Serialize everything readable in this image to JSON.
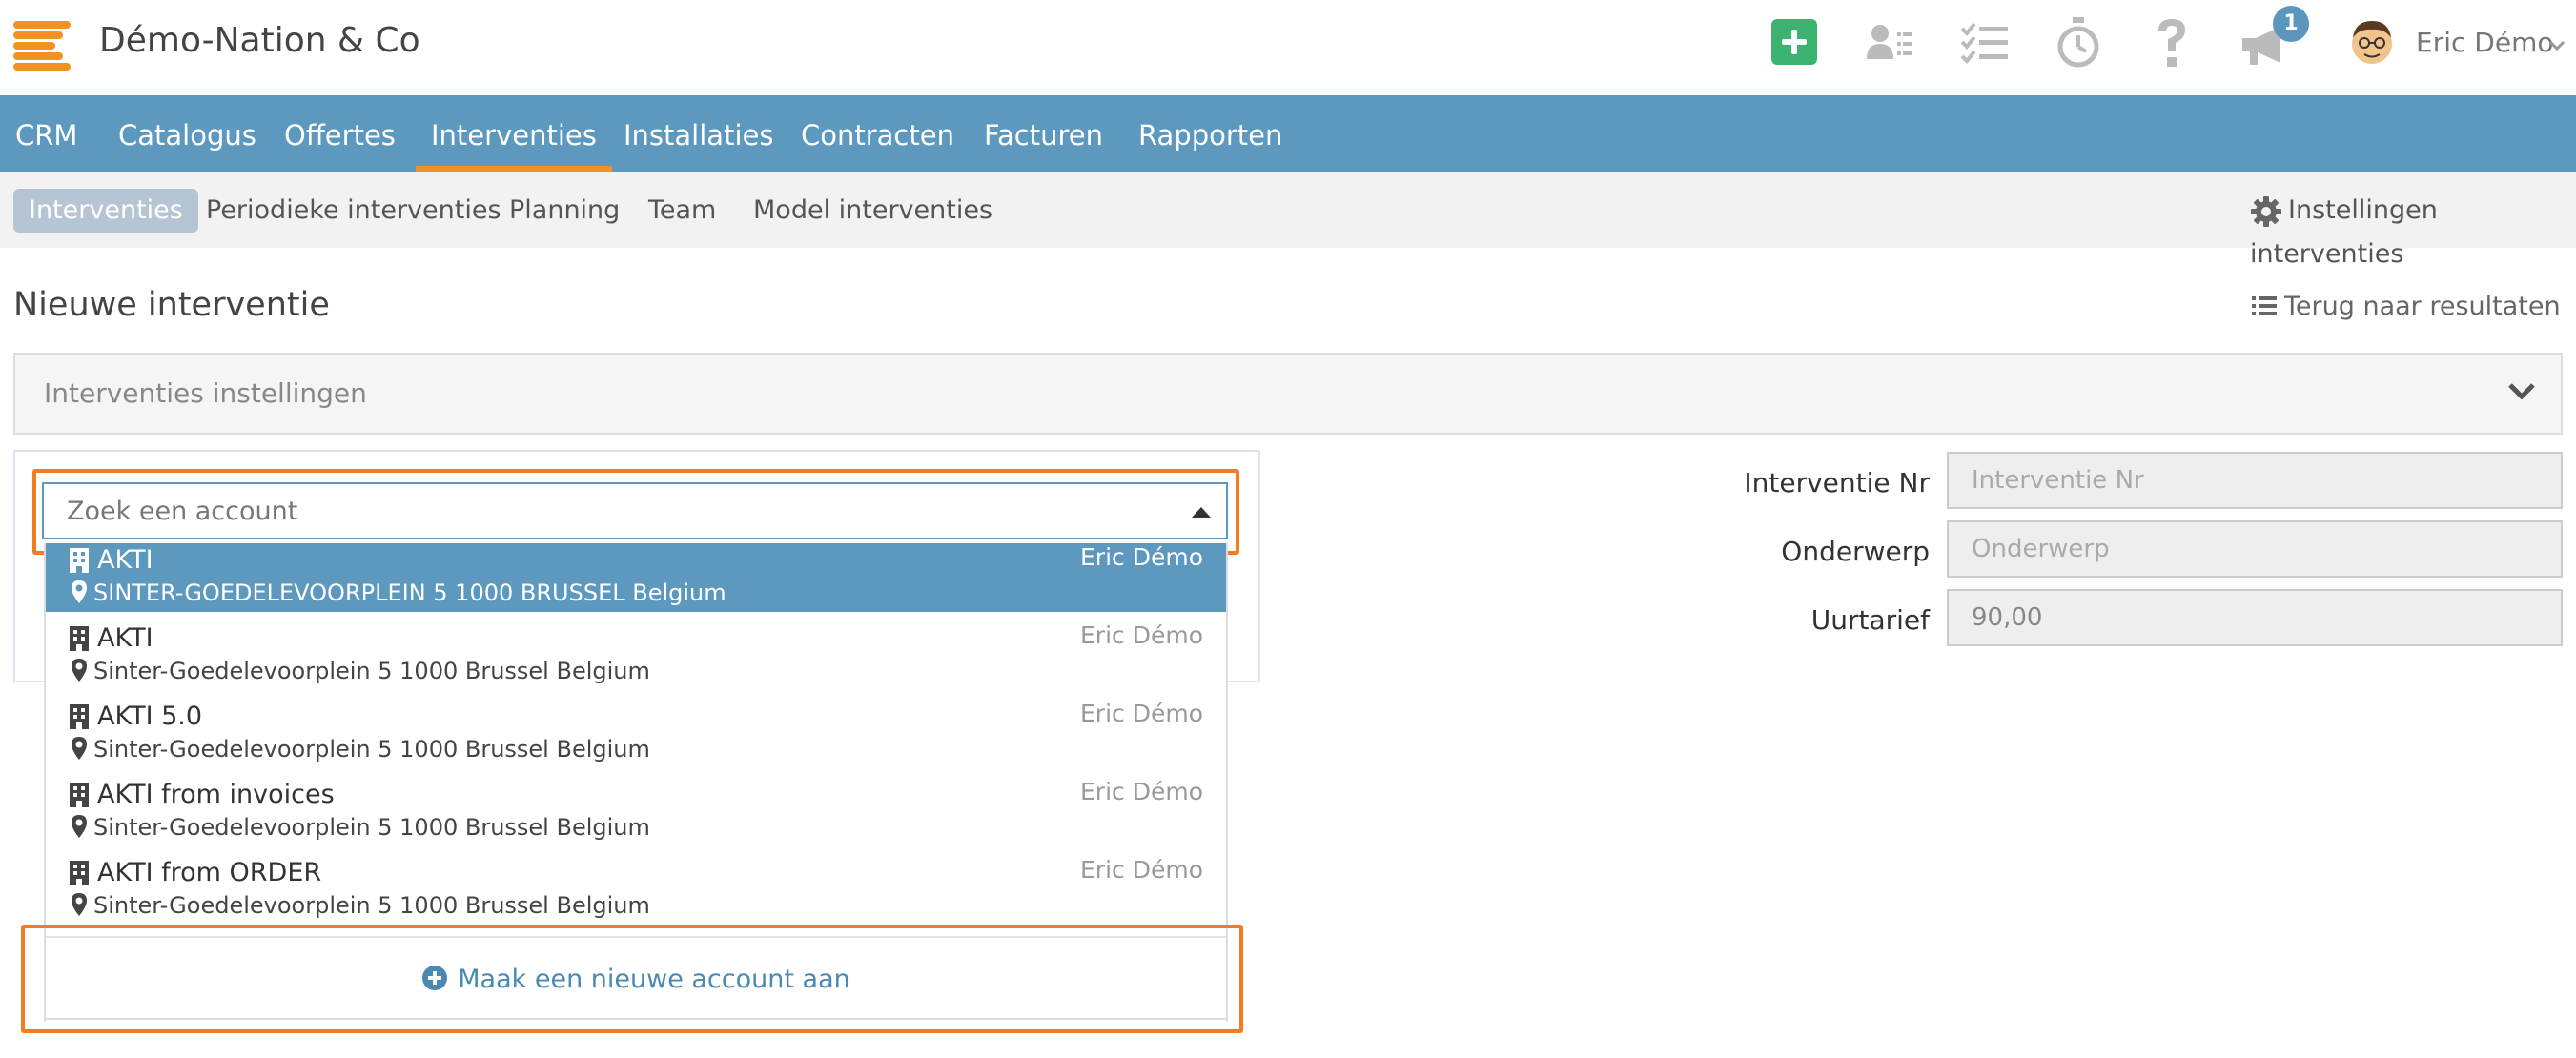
{
  "header": {
    "company": "Démo-Nation & Co",
    "notification_count": "1",
    "user_name": "Eric Démo",
    "icons": [
      "menu-logo-icon",
      "plus-icon",
      "contacts-icon",
      "tasks-icon",
      "stopwatch-icon",
      "help-icon",
      "megaphone-icon",
      "avatar",
      "chevron-down-icon"
    ],
    "colors": {
      "accent": "#f39222",
      "nav": "#5d98be",
      "add": "#3cb371"
    }
  },
  "main_nav": {
    "items": [
      "CRM",
      "Catalogus",
      "Offertes",
      "Interventies",
      "Installaties",
      "Contracten",
      "Facturen",
      "Rapporten"
    ],
    "active": "Interventies"
  },
  "sub_nav": {
    "items": [
      "Interventies",
      "Periodieke interventies",
      "Planning",
      "Team",
      "Model interventies"
    ],
    "active": "Interventies",
    "settings": "Instellingen interventies"
  },
  "page": {
    "title": "Nieuwe interventie",
    "back": "Terug naar resultaten"
  },
  "panel": {
    "title": "Interventies instellingen"
  },
  "account_search": {
    "placeholder": "Zoek een account",
    "results": [
      {
        "name": "AKTI",
        "owner": "Eric Démo",
        "address": "SINTER-GOEDELEVOORPLEIN 5 1000 BRUSSEL Belgium",
        "selected": true
      },
      {
        "name": "AKTI",
        "owner": "Eric Démo",
        "address": "Sinter-Goedelevoorplein 5 1000 Brussel Belgium"
      },
      {
        "name": "AKTI 5.0",
        "owner": "Eric Démo",
        "address": "Sinter-Goedelevoorplein 5 1000 Brussel Belgium"
      },
      {
        "name": "AKTI from invoices",
        "owner": "Eric Démo",
        "address": "Sinter-Goedelevoorplein 5 1000 Brussel Belgium"
      },
      {
        "name": "AKTI from ORDER",
        "owner": "Eric Démo",
        "address": "Sinter-Goedelevoorplein 5 1000 Brussel Belgium"
      }
    ],
    "create_new": "Maak een nieuwe account aan"
  },
  "form": {
    "intervention_nr": {
      "label": "Interventie Nr",
      "placeholder": "Interventie Nr",
      "value": ""
    },
    "subject": {
      "label": "Onderwerp",
      "placeholder": "Onderwerp",
      "value": ""
    },
    "hourly_rate": {
      "label": "Uurtarief",
      "placeholder": "",
      "value": "90,00"
    }
  }
}
